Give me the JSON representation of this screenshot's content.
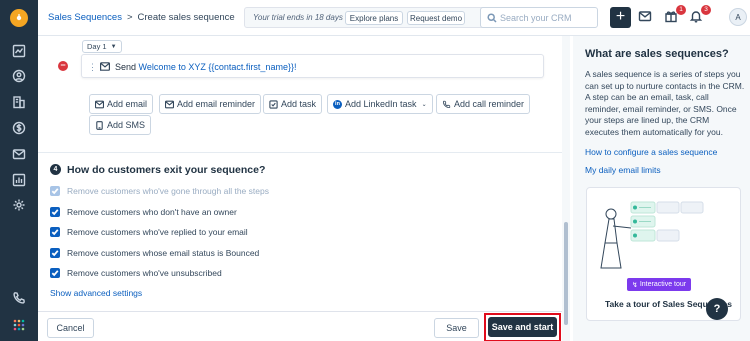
{
  "breadcrumb": {
    "parent": "Sales Sequences",
    "separator": ">",
    "current": "Create sales sequence"
  },
  "trial": {
    "text": "Your trial ends in 18 days",
    "explore": "Explore plans",
    "demo": "Request demo"
  },
  "search": {
    "placeholder": "Search your CRM"
  },
  "topbar": {
    "add_label": "+",
    "gift_badge": "1",
    "bell_badge": "3",
    "avatar_initial": "A"
  },
  "step": {
    "day_label": "Day 1",
    "action": "Send",
    "template": "Welcome to XYZ {{contact.first_name}}!"
  },
  "add_actions": {
    "email": "Add email",
    "email_reminder": "Add email reminder",
    "task": "Add task",
    "linkedin_task": "Add LinkedIn task",
    "linkedin_icon": "in",
    "call_reminder": "Add call reminder",
    "sms": "Add SMS"
  },
  "exit_section": {
    "number": "4",
    "title": "How do customers exit your sequence?",
    "options": [
      {
        "label": "Remove customers who've gone through all the steps",
        "checked": true,
        "disabled": true
      },
      {
        "label": "Remove customers who don't have an owner",
        "checked": true,
        "disabled": false
      },
      {
        "label": "Remove customers who've replied to your email",
        "checked": true,
        "disabled": false
      },
      {
        "label": "Remove customers whose email status is Bounced",
        "checked": true,
        "disabled": false
      },
      {
        "label": "Remove customers who've unsubscribed",
        "checked": true,
        "disabled": false
      }
    ],
    "advanced_link": "Show advanced settings"
  },
  "footer": {
    "cancel": "Cancel",
    "save": "Save",
    "save_start": "Save and start"
  },
  "sidepanel": {
    "title": "What are sales sequences?",
    "description": "A sales sequence is a series of steps you can set up to nurture contacts in the CRM. A step can be an email, task, call reminder, email reminder, or SMS. Once your steps are lined up, the CRM executes them automatically for you.",
    "link_configure": "How to configure a sales sequence",
    "link_limits": "My daily email limits",
    "tour_tag": "Interactive tour",
    "tour_title": "Take a tour of Sales Sequences",
    "help": "?"
  },
  "colors": {
    "nav_bg": "#213343",
    "link": "#0b5fbf",
    "primary": "#213343",
    "highlight": "#e00c1c",
    "badge": "#d9363e",
    "tour_tag": "#7c3aed"
  }
}
